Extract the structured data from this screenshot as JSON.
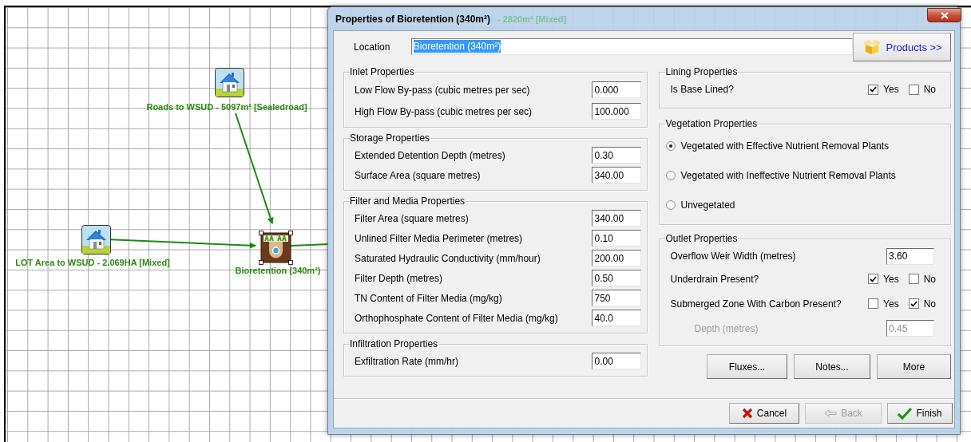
{
  "canvas": {
    "nodes": [
      {
        "kind": "source",
        "label": "Roads to WSUD - 5097m²  [Sealedroad]",
        "selected": false
      },
      {
        "kind": "source",
        "label": "LOT Area to WSUD - 2.069HA  [Mixed]",
        "selected": false
      },
      {
        "kind": "bioretention",
        "label": "Bioretention (340m²)",
        "selected": true
      }
    ],
    "background_label": "- 2820m²  [Mixed]"
  },
  "dialog": {
    "title": "Properties of Bioretention (340m²)",
    "location": {
      "label": "Location",
      "value": "Bioretention (340m²)",
      "text_selected": true
    },
    "products_button": "Products >>",
    "left_groups": [
      {
        "title": "Inlet Properties",
        "fields": [
          {
            "label": "Low Flow By-pass (cubic metres per sec)",
            "value": "0.000"
          },
          {
            "label": "High Flow By-pass (cubic metres per sec)",
            "value": "100.000"
          }
        ]
      },
      {
        "title": "Storage Properties",
        "fields": [
          {
            "label": "Extended Detention Depth (metres)",
            "value": "0.30"
          },
          {
            "label": "Surface Area (square metres)",
            "value": "340.00"
          }
        ]
      },
      {
        "title": "Filter and Media Properties",
        "fields": [
          {
            "label": "Filter Area (square metres)",
            "value": "340.00"
          },
          {
            "label": "Unlined Filter Media Perimeter (metres)",
            "value": "0.10"
          },
          {
            "label": "Saturated Hydraulic Conductivity (mm/hour)",
            "value": "200.00"
          },
          {
            "label": "Filter Depth (metres)",
            "value": "0.50"
          },
          {
            "label": "TN Content of Filter Media (mg/kg)",
            "value": "750"
          },
          {
            "label": "Orthophosphate Content of Filter Media (mg/kg)",
            "value": "40.0"
          }
        ]
      },
      {
        "title": "Infiltration Properties",
        "fields": [
          {
            "label": "Exfiltration Rate (mm/hr)",
            "value": "0.00"
          }
        ]
      }
    ],
    "lining": {
      "title": "Lining Properties",
      "rows": [
        {
          "kind": "yesno",
          "label": "Is Base Lined?",
          "options": [
            {
              "label": "Yes",
              "checked": true
            },
            {
              "label": "No",
              "checked": false
            }
          ]
        }
      ]
    },
    "vegetation": {
      "title": "Vegetation Properties",
      "options": [
        {
          "label": "Vegetated with Effective Nutrient Removal Plants",
          "selected": true
        },
        {
          "label": "Vegetated with Ineffective Nutrient Removal Plants",
          "selected": false
        },
        {
          "label": "Unvegetated",
          "selected": false
        }
      ]
    },
    "outlet": {
      "title": "Outlet Properties",
      "rows": [
        {
          "kind": "field",
          "label": "Overflow Weir Width (metres)",
          "value": "3.60",
          "disabled": false
        },
        {
          "kind": "yesno",
          "label": "Underdrain Present?",
          "options": [
            {
              "label": "Yes",
              "checked": true
            },
            {
              "label": "No",
              "checked": false
            }
          ]
        },
        {
          "kind": "yesno",
          "label": "Submerged Zone With Carbon Present?",
          "options": [
            {
              "label": "Yes",
              "checked": false
            },
            {
              "label": "No",
              "checked": true
            }
          ]
        },
        {
          "kind": "field",
          "label": "Depth (metres)",
          "value": "0.45",
          "disabled": true
        }
      ]
    },
    "action_buttons": [
      "Fluxes...",
      "Notes...",
      "More"
    ],
    "footer_buttons": [
      {
        "kind": "cancel",
        "label": "Cancel",
        "disabled": false
      },
      {
        "kind": "back",
        "label": "Back",
        "disabled": true
      },
      {
        "kind": "finish",
        "label": "Finish",
        "disabled": false
      }
    ]
  }
}
